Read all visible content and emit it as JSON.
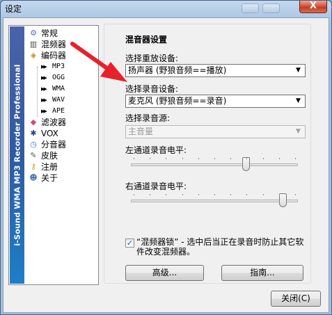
{
  "window": {
    "title": "设定",
    "close_label": "X"
  },
  "nav": {
    "banner_text": "i-Sound WMA MP3 Recorder Professional",
    "items": [
      {
        "label": "常规",
        "icon": "gear-icon",
        "glyph": "⚙",
        "color": "#5a6db5"
      },
      {
        "label": "混频器",
        "icon": "mixer-icon",
        "glyph": "▥",
        "color": "#4a4a4a"
      },
      {
        "label": "编码器",
        "icon": "encoder-icon",
        "glyph": "◈",
        "color": "#c88a1a"
      }
    ],
    "sub_items": [
      "MP3",
      "OGG",
      "WMA",
      "WAV",
      "APE"
    ],
    "items2": [
      {
        "label": "滤波器",
        "icon": "filter-icon",
        "glyph": "◆",
        "color": "#d04a7a"
      },
      {
        "label": "VOX",
        "icon": "vox-icon",
        "glyph": "✱",
        "color": "#2f3f8f"
      },
      {
        "label": "分音器",
        "icon": "splitter-icon",
        "glyph": "◷",
        "color": "#3a7ac0"
      },
      {
        "label": "皮肤",
        "icon": "skin-icon",
        "glyph": "✎",
        "color": "#3a6a3a"
      },
      {
        "label": "注册",
        "icon": "key-icon",
        "glyph": "⚷",
        "color": "#d0a020"
      },
      {
        "label": "关于",
        "icon": "users-icon",
        "glyph": "☻",
        "color": "#4a78b8"
      }
    ]
  },
  "mixer": {
    "group_title": "混音器设置",
    "playback_label": "选择重放设备:",
    "playback_value": "扬声器 (野狼音频==播放)",
    "record_label": "选择录音设备:",
    "record_value": "麦克风 (野狼音频==录音)",
    "source_label": "选择录音源:",
    "source_value": "主音量",
    "left_label": "左通道录音电平:",
    "left_level": 0.7,
    "right_label": "右通道录音电平:",
    "right_level": 0.93,
    "lock_checked": true,
    "lock_text": "“混频器锁” - 选中后当正在录音时防止其它软件改变混频器。",
    "advanced_button": "高级...",
    "guide_button": "指南..."
  },
  "footer": {
    "close_button": "关闭(C)"
  },
  "colors": {
    "annotation_arrow": "#e8202a"
  }
}
